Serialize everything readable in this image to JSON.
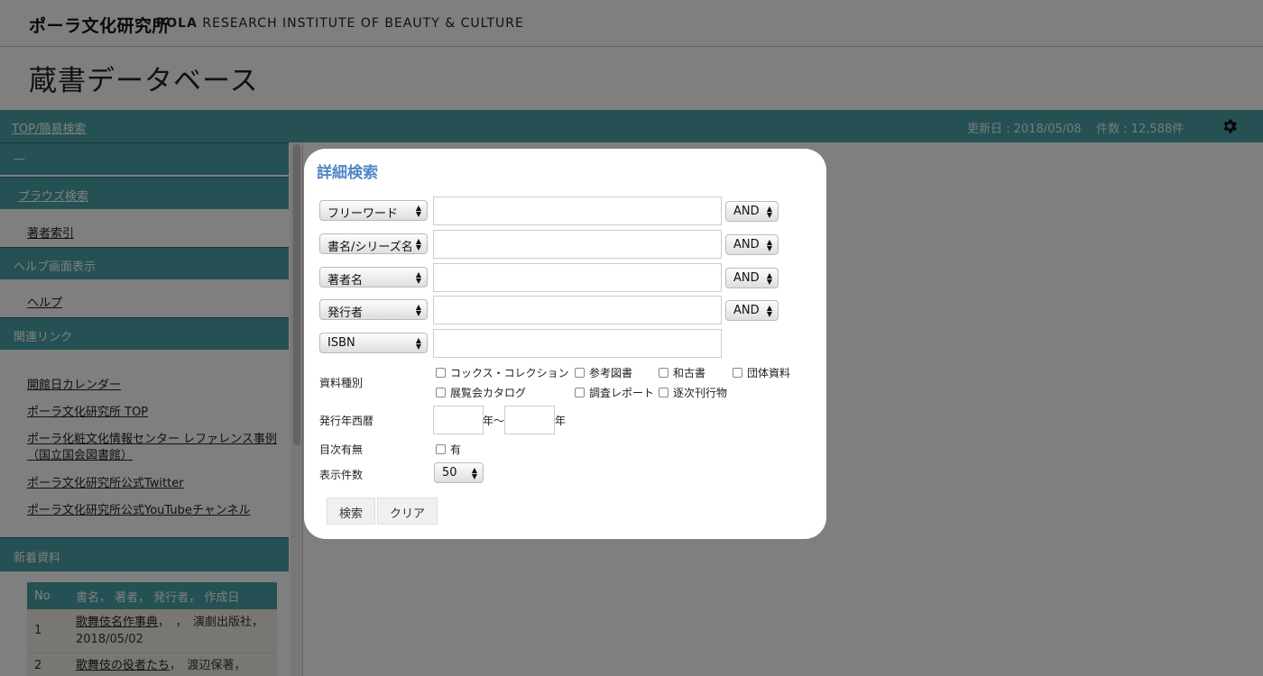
{
  "header": {
    "logo_jp": "ポーラ文化研究所",
    "logo_en_bold": "POLA",
    "logo_en_rest": "RESEARCH INSTITUTE OF BEAUTY & CULTURE",
    "page_title": "蔵書データベース"
  },
  "navbar": {
    "top_link": "TOP/簡易検索",
    "updated": "更新日 : 2018/05/08",
    "count": "件数 : 12,588件",
    "settings_icon": "gear-icon"
  },
  "sidebar": {
    "dash": "—",
    "browse_head": "ブラウズ検索",
    "author_index": "著者索引",
    "help_head": "ヘルプ画面表示",
    "help": "ヘルプ",
    "links_head": "関連リンク",
    "links": [
      "開館日カレンダー",
      "ポーラ文化研究所 TOP",
      "ポーラ化粧文化情報センター レファレンス事例",
      "（国立国会図書館）",
      "ポーラ文化研究所公式Twitter",
      "ポーラ文化研究所公式YouTubeチャンネル"
    ],
    "new_head": "新着資料",
    "table": {
      "col_no": "No",
      "col_info": "書名， 著者， 発行者， 作成日",
      "rows": [
        {
          "no": "1",
          "title": "歌舞伎名作事典",
          "rest": "，　，　演劇出版社，2018/05/02"
        },
        {
          "no": "2",
          "title": "歌舞伎の役者たち",
          "rest": "，　渡辺保著，　駿々"
        }
      ]
    }
  },
  "modal": {
    "title": "詳細検索",
    "fields": [
      {
        "field": "フリーワード",
        "op": "AND"
      },
      {
        "field": "書名/シリーズ名",
        "op": "AND"
      },
      {
        "field": "著者名",
        "op": "AND"
      },
      {
        "field": "発行者",
        "op": "AND"
      },
      {
        "field": "ISBN"
      }
    ],
    "material_label": "資料種別",
    "materials": [
      "コックス・コレクション",
      "参考図書",
      "和古書",
      "団体資料",
      "展覧会カタログ",
      "調査レポート",
      "逐次刊行物"
    ],
    "year_label": "発行年西暦",
    "year_from_suffix": "年〜",
    "year_to_suffix": "年",
    "toc_label": "目次有無",
    "toc_option": "有",
    "perpage_label": "表示件数",
    "perpage_value": "50",
    "search_btn": "検索",
    "clear_btn": "クリア"
  }
}
